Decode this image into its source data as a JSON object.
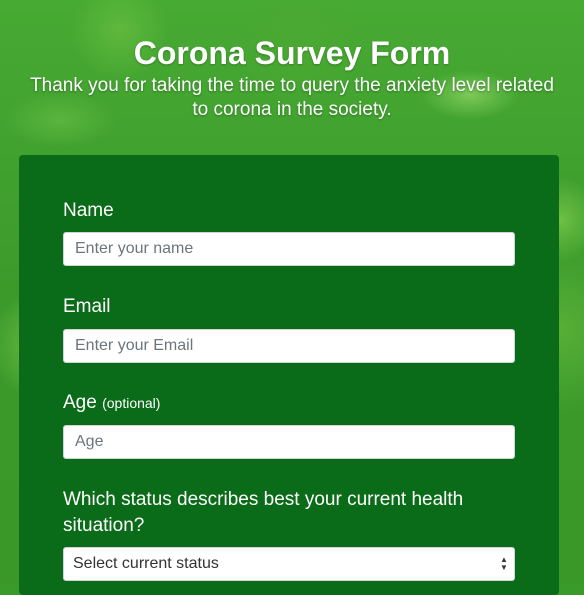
{
  "header": {
    "title": "Corona Survey Form",
    "subtitle": "Thank you for taking the time to query the anxiety level related to corona in the society."
  },
  "form": {
    "name": {
      "label": "Name",
      "placeholder": "Enter your name"
    },
    "email": {
      "label": "Email",
      "placeholder": "Enter your Email"
    },
    "age": {
      "label": "Age",
      "optional": "(optional)",
      "placeholder": "Age"
    },
    "status": {
      "question": "Which status describes best your current health situation?",
      "selected": "Select current status"
    }
  },
  "colors": {
    "background": "#3a9a2a",
    "card": "#0a6b18"
  }
}
